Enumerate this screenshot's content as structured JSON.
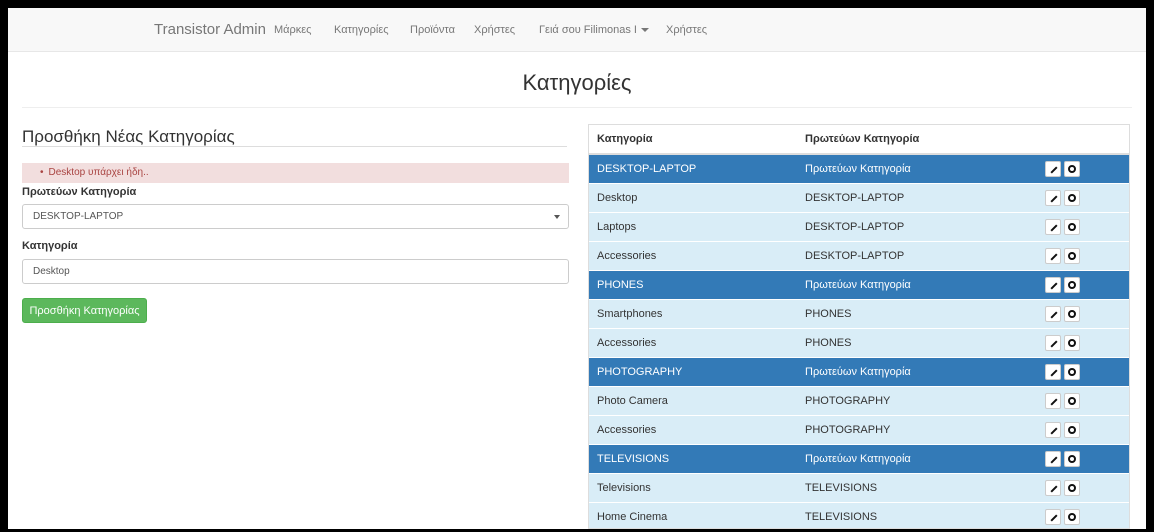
{
  "navbar": {
    "brand": "Transistor Admin",
    "links": [
      "Μάρκες",
      "Κατηγορίες",
      "Προϊόντα",
      "Χρήστες",
      "Γειά σου Filimonas I",
      "Χρήστες"
    ]
  },
  "page": {
    "title": "Κατηγορίες"
  },
  "form": {
    "heading": "Προσθήκη Νέας Κατηγορίας",
    "error": "Desktop υπάρχει ήδη..",
    "parent_label": "Πρωτεύων Κατηγορία",
    "parent_value": "DESKTOP-LAPTOP",
    "category_label": "Κατηγορία",
    "category_value": "Desktop",
    "submit_label": "Προσθήκη Κατηγορίας"
  },
  "table": {
    "headers": [
      "Κατηγορία",
      "Πρωτεύων Κατηγορία",
      ""
    ],
    "rows": [
      {
        "name": "DESKTOP-LAPTOP",
        "parent": "Πρωτεύων Κατηγορία",
        "is_parent": true
      },
      {
        "name": "Desktop",
        "parent": "DESKTOP-LAPTOP",
        "is_parent": false
      },
      {
        "name": "Laptops",
        "parent": "DESKTOP-LAPTOP",
        "is_parent": false
      },
      {
        "name": "Accessories",
        "parent": "DESKTOP-LAPTOP",
        "is_parent": false
      },
      {
        "name": "PHONES",
        "parent": "Πρωτεύων Κατηγορία",
        "is_parent": true
      },
      {
        "name": "Smartphones",
        "parent": "PHONES",
        "is_parent": false
      },
      {
        "name": "Accessories",
        "parent": "PHONES",
        "is_parent": false
      },
      {
        "name": "PHOTOGRAPHY",
        "parent": "Πρωτεύων Κατηγορία",
        "is_parent": true
      },
      {
        "name": "Photo Camera",
        "parent": "PHOTOGRAPHY",
        "is_parent": false
      },
      {
        "name": "Accessories",
        "parent": "PHOTOGRAPHY",
        "is_parent": false
      },
      {
        "name": "TELEVISIONS",
        "parent": "Πρωτεύων Κατηγορία",
        "is_parent": true
      },
      {
        "name": "Televisions",
        "parent": "TELEVISIONS",
        "is_parent": false
      },
      {
        "name": "Home Cinema",
        "parent": "TELEVISIONS",
        "is_parent": false
      }
    ],
    "row_actions": [
      "pencil-icon",
      "remove-icon"
    ]
  },
  "colors": {
    "parent_row": "#337ab7",
    "child_row": "#d9edf7",
    "success_button": "#5cb85c",
    "alert_bg": "#f2dede",
    "alert_text": "#a94442"
  }
}
